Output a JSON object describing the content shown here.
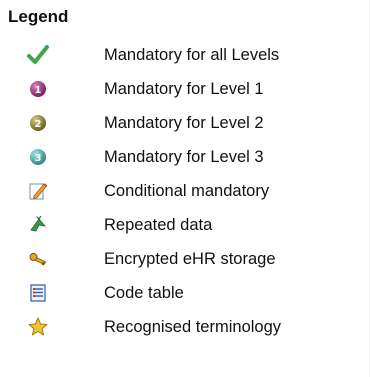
{
  "legend": {
    "title": "Legend",
    "items": [
      {
        "icon": "checkmark-icon",
        "label": "Mandatory for all Levels"
      },
      {
        "icon": "level-1-badge-icon",
        "label": "Mandatory for Level 1"
      },
      {
        "icon": "level-2-badge-icon",
        "label": "Mandatory for Level 2"
      },
      {
        "icon": "level-3-badge-icon",
        "label": "Mandatory for Level 3"
      },
      {
        "icon": "pencil-note-icon",
        "label": "Conditional mandatory"
      },
      {
        "icon": "repeat-arrow-icon",
        "label": "Repeated data"
      },
      {
        "icon": "key-icon",
        "label": "Encrypted eHR storage"
      },
      {
        "icon": "table-list-icon",
        "label": "Code table"
      },
      {
        "icon": "star-icon",
        "label": "Recognised terminology"
      }
    ]
  },
  "colors": {
    "check": "#3aa64a",
    "level1": "#9a2e7a",
    "level2": "#8a7a2c",
    "level3": "#3ea8a8",
    "pencil": "#f0a13b",
    "repeat": "#3a9a4a",
    "key": "#c08a1a",
    "table": "#2b5ea7",
    "star": "#f2c230"
  }
}
